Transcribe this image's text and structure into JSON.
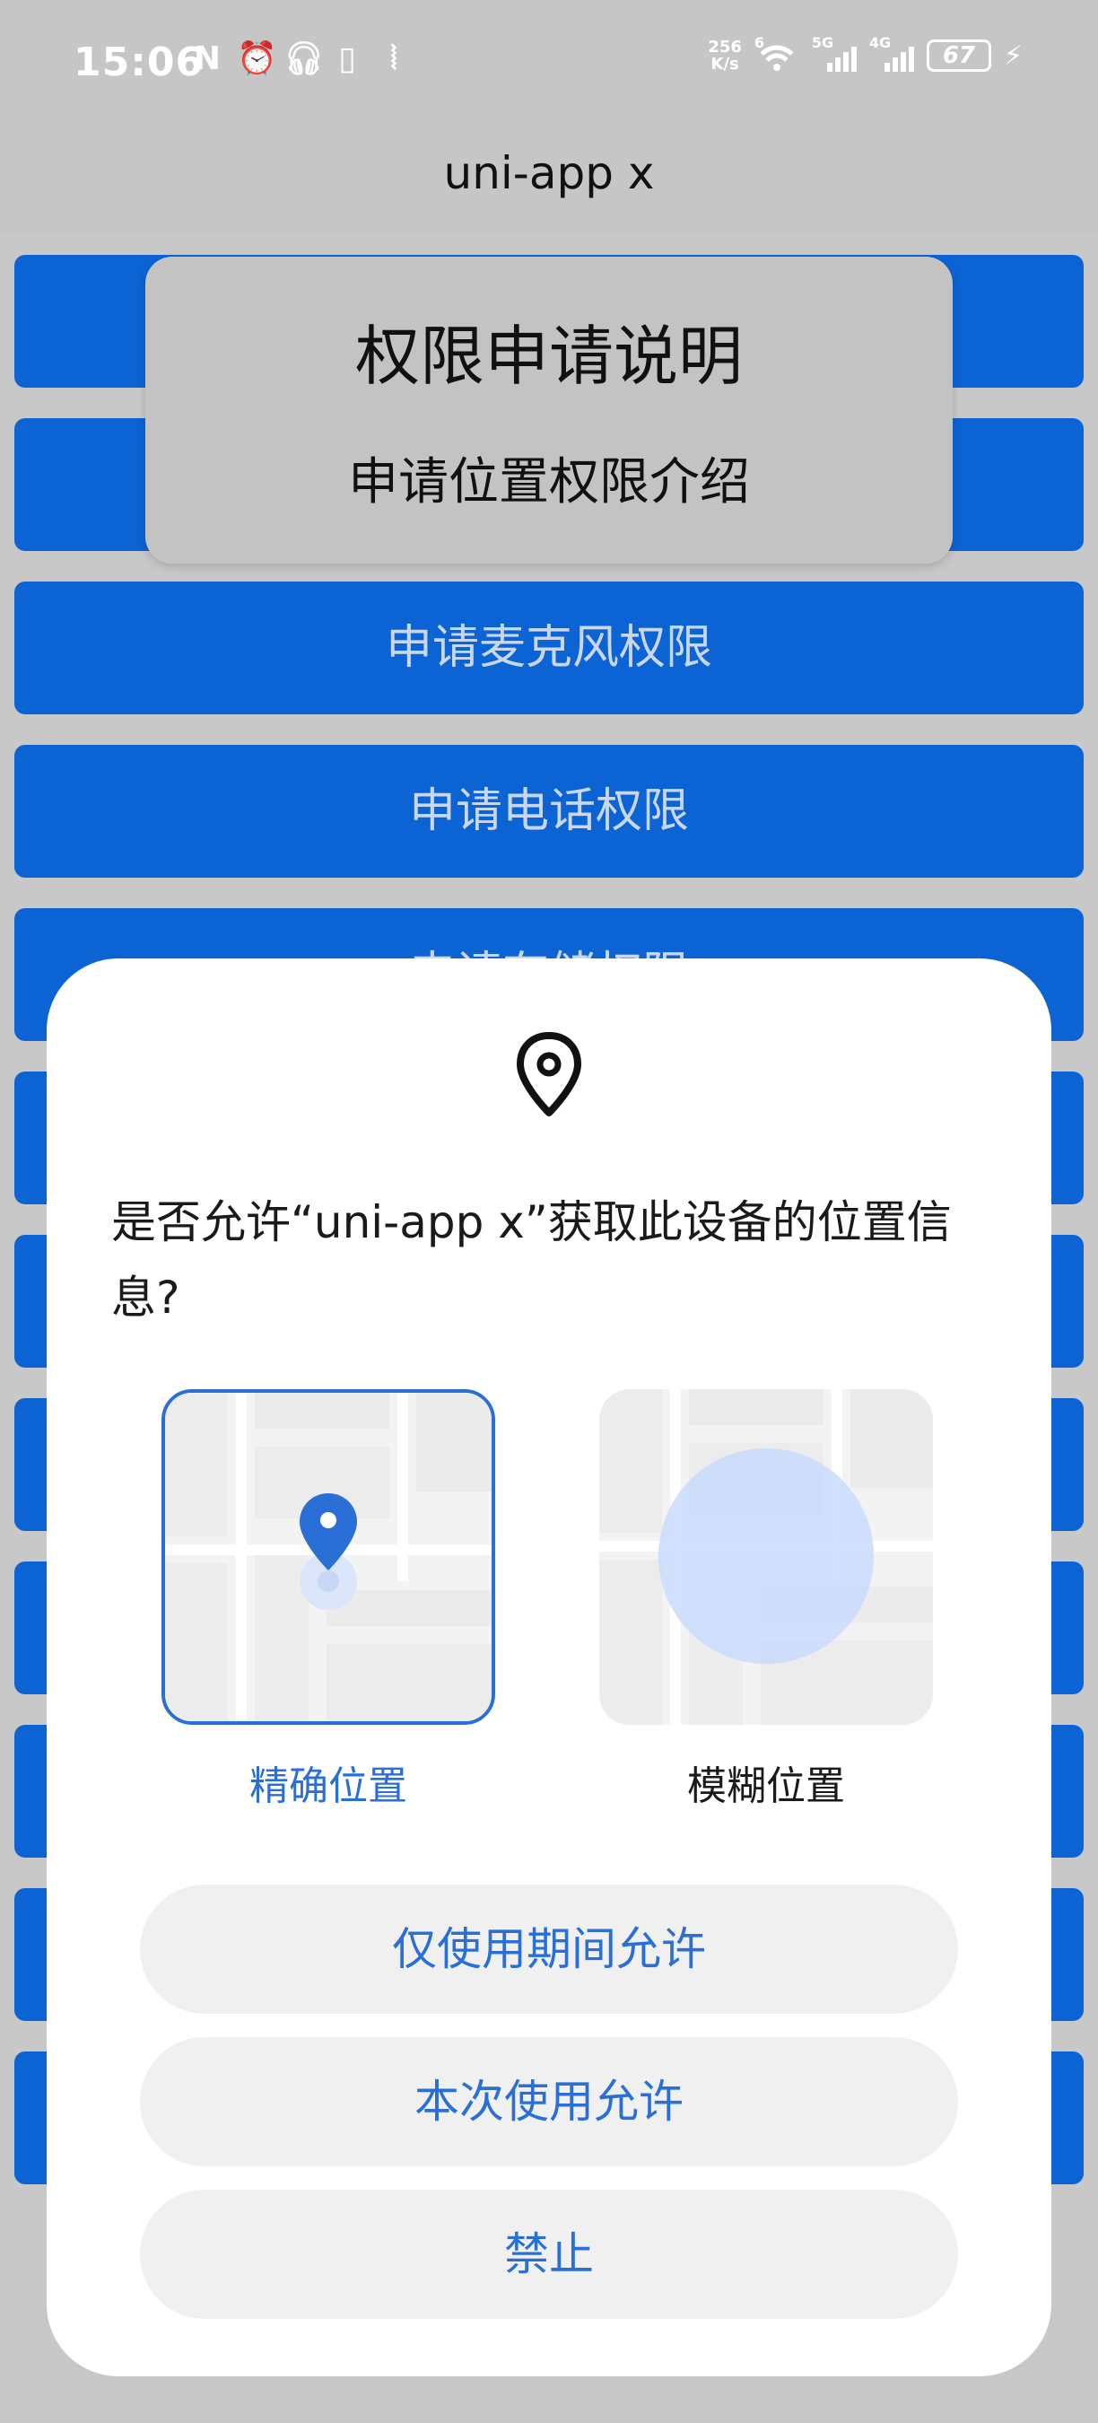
{
  "status_bar": {
    "time": "15:06",
    "left_icons": [
      "nfc-icon",
      "alarm-icon",
      "headphones-icon",
      "phone-icon",
      "vibrate-icon"
    ],
    "net_speed": "256 K/s",
    "wifi_label": "6",
    "sim1_label": "5G",
    "sim2_label": "4G",
    "battery": "67"
  },
  "app": {
    "title": "uni-app x"
  },
  "background_buttons": [
    "",
    "",
    "申请麦克风权限",
    "申请电话权限",
    "申请存储权限",
    "",
    "",
    "",
    "",
    "",
    "",
    ""
  ],
  "explain_card": {
    "title": "权限申请说明",
    "subtitle": "申请位置权限介绍"
  },
  "dialog": {
    "icon": "location-pin-icon",
    "question": "是否允许“uni-app x”获取此设备的位置信息?",
    "options": [
      {
        "label": "精确位置",
        "selected": true
      },
      {
        "label": "模糊位置",
        "selected": false
      }
    ],
    "buttons": [
      "仅使用期间允许",
      "本次使用允许",
      "禁止"
    ],
    "accent_color": "#2a6fd6"
  }
}
